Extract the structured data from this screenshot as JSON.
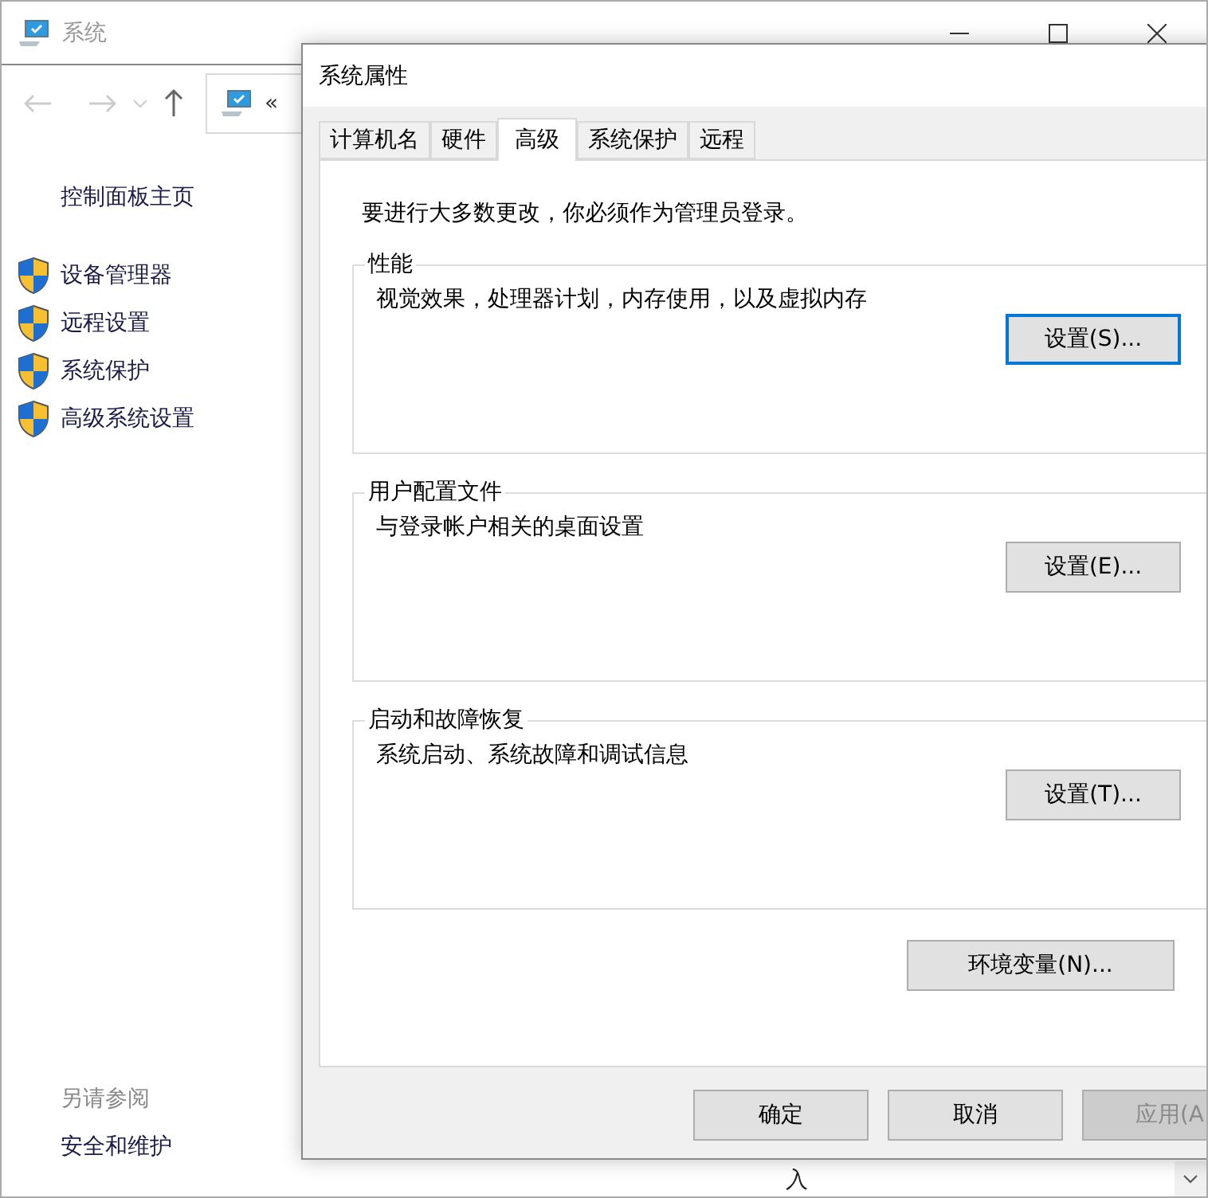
{
  "window": {
    "title": "系统",
    "address_prefix": "«"
  },
  "sidebar": {
    "home": "控制面板主页",
    "links": [
      "设备管理器",
      "远程设置",
      "系统保护",
      "高级系统设置"
    ],
    "see_also_heading": "另请参阅",
    "see_also_links": [
      "安全和维护"
    ]
  },
  "content": {
    "cut_text": "入"
  },
  "dialog": {
    "title": "系统属性",
    "tabs": [
      {
        "label": "计算机名",
        "selected": false
      },
      {
        "label": "硬件",
        "selected": false
      },
      {
        "label": "高级",
        "selected": true
      },
      {
        "label": "系统保护",
        "selected": false
      },
      {
        "label": "远程",
        "selected": false
      }
    ],
    "admin_note": "要进行大多数更改，你必须作为管理员登录。",
    "groups": [
      {
        "title": "性能",
        "description": "视觉效果，处理器计划，内存使用，以及虚拟内存",
        "button": "设置(S)...",
        "focused": true
      },
      {
        "title": "用户配置文件",
        "description": "与登录帐户相关的桌面设置",
        "button": "设置(E)...",
        "focused": false
      },
      {
        "title": "启动和故障恢复",
        "description": "系统启动、系统故障和调试信息",
        "button": "设置(T)...",
        "focused": false
      }
    ],
    "env_button": "环境变量(N)...",
    "buttons": [
      {
        "label": "确定",
        "disabled": false
      },
      {
        "label": "取消",
        "disabled": false
      },
      {
        "label": "应用(A",
        "disabled": true
      }
    ]
  }
}
